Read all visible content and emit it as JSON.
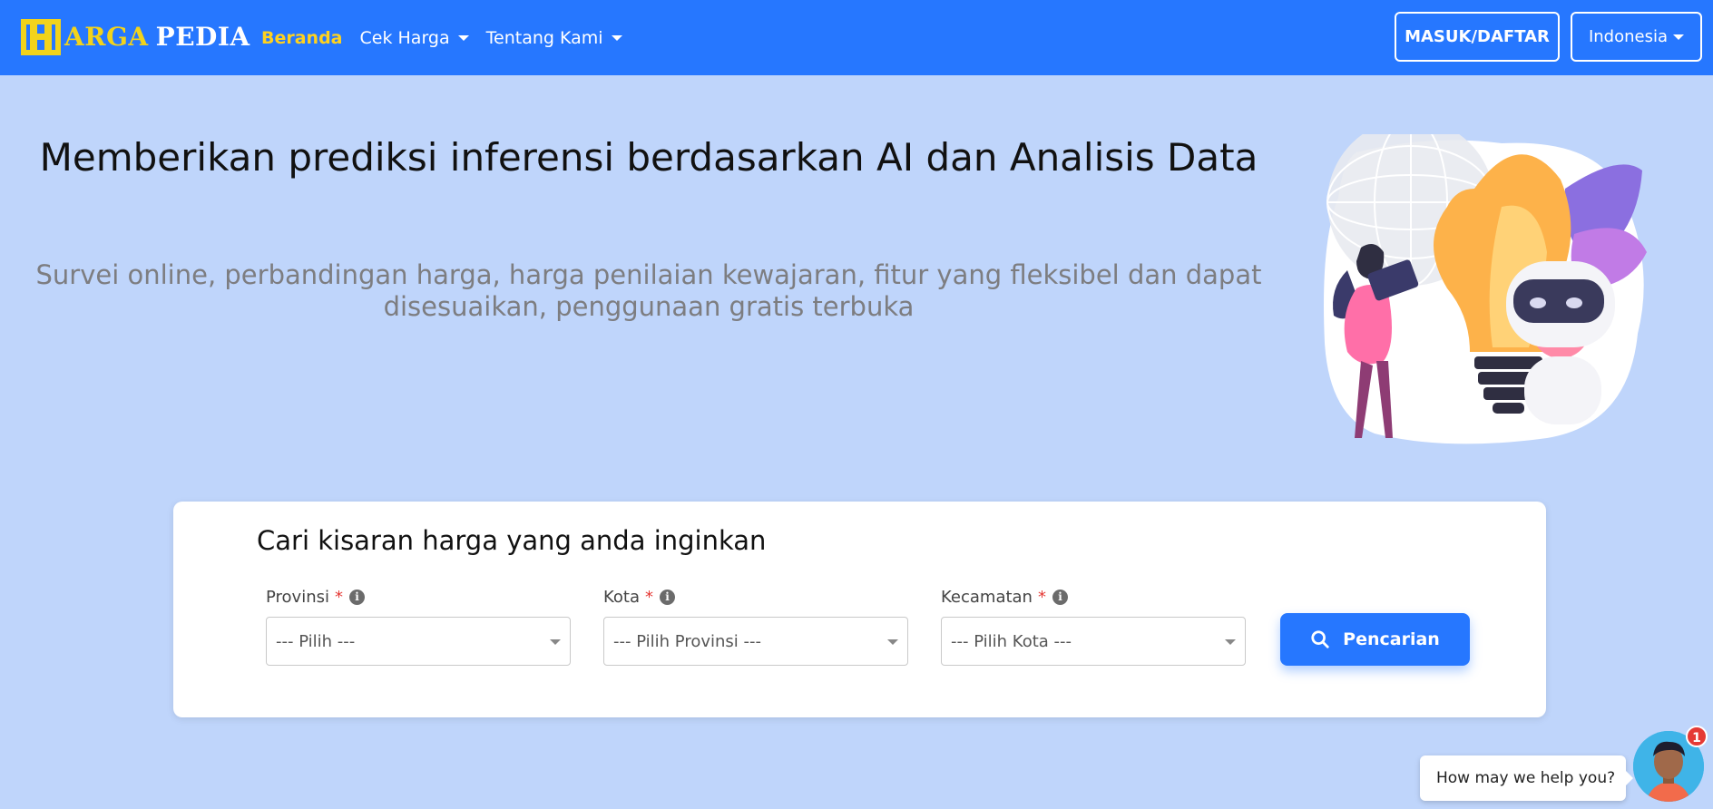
{
  "navbar": {
    "brand_part1": "ARGA",
    "brand_part2": "PEDIA",
    "links": [
      {
        "label": "Beranda",
        "active": true
      },
      {
        "label": "Cek Harga",
        "dropdown": true
      },
      {
        "label": "Tentang Kami",
        "dropdown": true
      }
    ],
    "login_label": "MASUK/DAFTAR",
    "language_label": "Indonesia"
  },
  "hero": {
    "title": "Memberikan prediksi inferensi berdasarkan AI dan Analisis Data",
    "subtitle": "Survei online, perbandingan harga, harga penilaian kewajaran, fitur yang fleksibel dan dapat disesuaikan, penggunaan gratis terbuka"
  },
  "search": {
    "title": "Cari kisaran harga yang anda inginkan",
    "fields": [
      {
        "label": "Provinsi",
        "required_mark": "*",
        "value": "--- Pilih ---"
      },
      {
        "label": "Kota",
        "required_mark": "*",
        "value": "--- Pilih Provinsi ---"
      },
      {
        "label": "Kecamatan",
        "required_mark": "*",
        "value": "--- Pilih Kota ---"
      }
    ],
    "button_label": "Pencarian"
  },
  "chat": {
    "prompt": "How may we help you?",
    "badge_count": "1"
  },
  "colors": {
    "primary": "#2677ff",
    "background": "#bfd5fb",
    "brand_yellow": "#f2d31b",
    "active_link": "#ffd21e",
    "required": "#e53935"
  },
  "icons": [
    "brand-logo-icon",
    "caret-down-icon",
    "info-icon",
    "search-icon",
    "support-avatar-icon"
  ]
}
